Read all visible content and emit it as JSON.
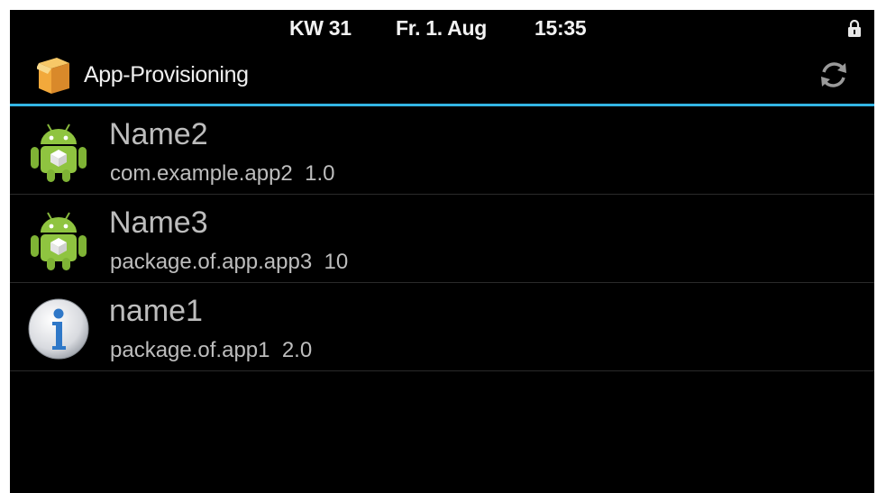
{
  "status_bar": {
    "week": "KW 31",
    "date": "Fr. 1. Aug",
    "time": "15:35",
    "lock_icon": "lock-icon"
  },
  "action_bar": {
    "app_icon": "package-box-icon",
    "title": "App-Provisioning",
    "refresh_icon": "refresh-icon",
    "accent_color": "#33b5e5"
  },
  "apps": [
    {
      "name": "Name2",
      "package": "com.example.app2",
      "version": "1.0",
      "icon": "android-robot-icon"
    },
    {
      "name": "Name3",
      "package": "package.of.app.app3",
      "version": "10",
      "icon": "android-robot-icon"
    },
    {
      "name": "name1",
      "package": "package.of.app1",
      "version": "2.0",
      "icon": "info-icon"
    }
  ]
}
